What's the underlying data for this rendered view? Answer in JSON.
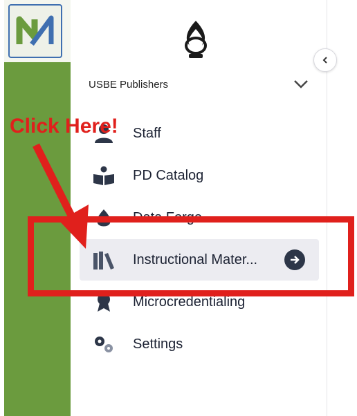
{
  "org": {
    "name": "USBE Publishers"
  },
  "nav": {
    "items": [
      {
        "label": "Staff",
        "icon": "person-icon"
      },
      {
        "label": "PD Catalog",
        "icon": "open-book-icon"
      },
      {
        "label": "Data Forge",
        "icon": "droplet-icon"
      },
      {
        "label": "Instructional Mater...",
        "icon": "books-icon",
        "active": true
      },
      {
        "label": "Microcredentialing",
        "icon": "award-icon"
      },
      {
        "label": "Settings",
        "icon": "gears-icon"
      }
    ]
  },
  "annotation": {
    "text": "Click Here!",
    "color": "#e0201c"
  },
  "colors": {
    "rail": "#6b9b3e",
    "accent_blue": "#3f6fb0",
    "text": "#1c2233",
    "annotation": "#e0201c"
  }
}
